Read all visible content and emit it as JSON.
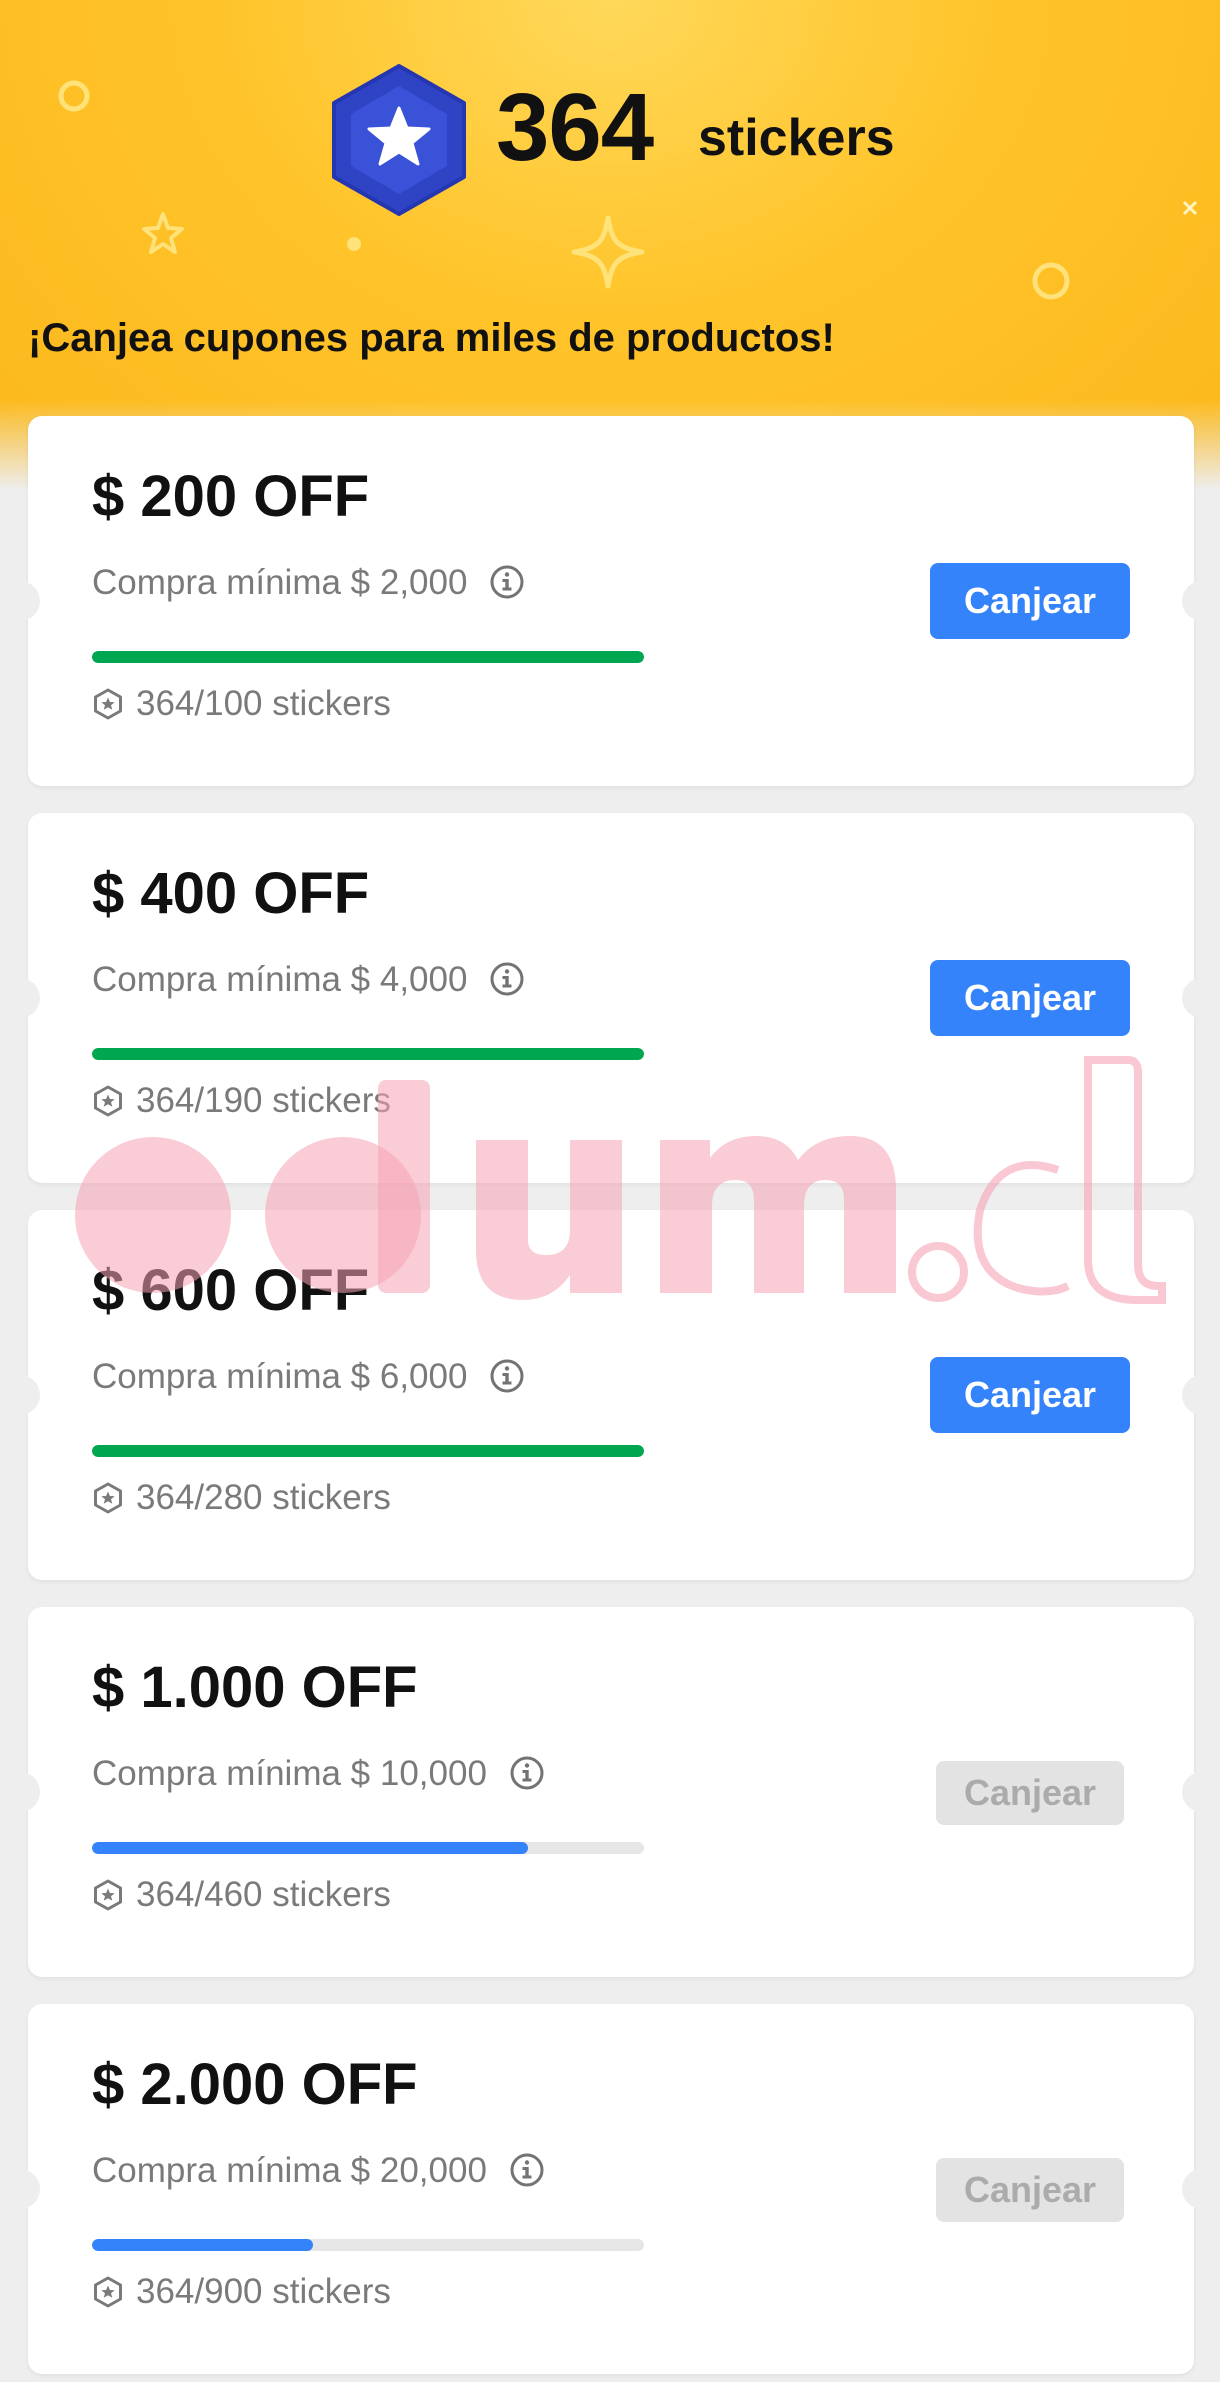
{
  "header": {
    "sticker_count": "364",
    "sticker_unit": "stickers",
    "subtitle": "¡Canjea cupones para miles de productos!",
    "badge_icon": "star-hexagon-icon",
    "colors": {
      "background": "#ffc42a",
      "badge": "#2f43c5"
    }
  },
  "coupons": [
    {
      "title": "$ 200 OFF",
      "min_purchase": "Compra mínima $ 2,000",
      "progress_text": "364/100 stickers",
      "progress_fraction": 1.0,
      "progress_color": "#00a650",
      "button_label": "Canjear",
      "button_enabled": true
    },
    {
      "title": "$ 400 OFF",
      "min_purchase": "Compra mínima $ 4,000",
      "progress_text": "364/190 stickers",
      "progress_fraction": 1.0,
      "progress_color": "#00a650",
      "button_label": "Canjear",
      "button_enabled": true
    },
    {
      "title": "$ 600 OFF",
      "min_purchase": "Compra mínima $ 6,000",
      "progress_text": "364/280 stickers",
      "progress_fraction": 1.0,
      "progress_color": "#00a650",
      "button_label": "Canjear",
      "button_enabled": true
    },
    {
      "title": "$ 1.000 OFF",
      "min_purchase": "Compra mínima $ 10,000",
      "progress_text": "364/460 stickers",
      "progress_fraction": 0.79,
      "progress_color": "#3483fa",
      "button_label": "Canjear",
      "button_enabled": false
    },
    {
      "title": "$ 2.000 OFF",
      "min_purchase": "Compra mínima $ 20,000",
      "progress_text": "364/900 stickers",
      "progress_fraction": 0.4,
      "progress_color": "#3483fa",
      "button_label": "Canjear",
      "button_enabled": false
    }
  ],
  "icons": {
    "info": "info-icon",
    "sticker": "sticker-hexagon-icon"
  },
  "watermark": {
    "text": "odum.cl",
    "color": "#f5a3b5"
  }
}
